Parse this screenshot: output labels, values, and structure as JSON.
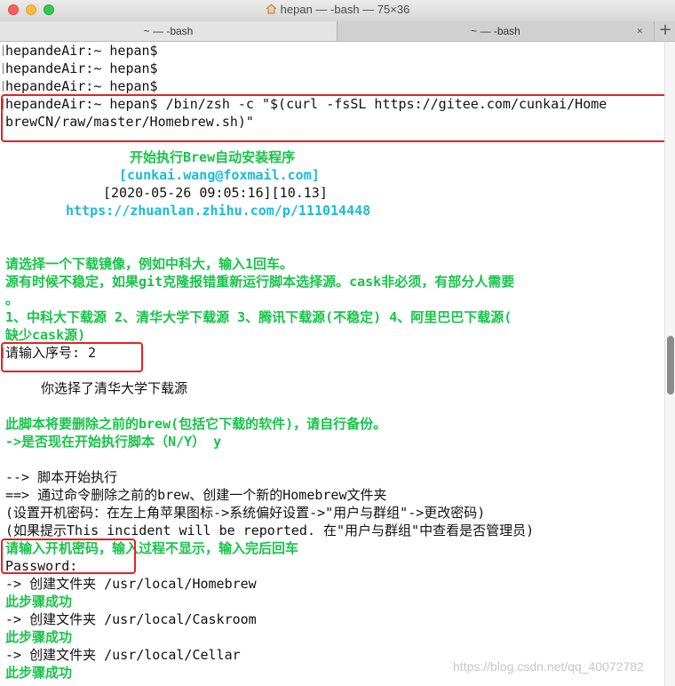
{
  "window": {
    "title": "hepan — -bash — 75×36"
  },
  "tabs": [
    {
      "label": "~ — -bash"
    },
    {
      "label": "~ — -bash"
    }
  ],
  "tab_controls": {
    "close": "×",
    "add": "+"
  },
  "terminal": {
    "lines": [
      "hepandeAir:~ hepan$",
      "hepandeAir:~ hepan$",
      "hepandeAir:~ hepan$",
      "hepandeAir:~ hepan$ /bin/zsh -c \"$(curl -fsSL https://gitee.com/cunkai/Home",
      "brewCN/raw/master/Homebrew.sh)\"",
      "开始执行Brew自动安装程序",
      "[cunkai.wang@foxmail.com]",
      "[2020-05-26 09:05:16][10.13]",
      "https://zhuanlan.zhihu.com/p/111014448",
      "请选择一个下载镜像，例如中科大，输入1回车。",
      "源有时候不稳定，如果git克隆报错重新运行脚本选择源。cask非必须，有部分人需要",
      "。",
      "1、中科大下载源 2、清华大学下载源 3、腾讯下载源(不稳定) 4、阿里巴巴下载源(",
      "缺少cask源)",
      "请输入序号: 2",
      "你选择了清华大学下载源",
      "此脚本将要删除之前的brew(包括它下载的软件)，请自行备份。",
      "->是否现在开始执行脚本（N/Y） y",
      "--> 脚本开始执行",
      "==> 通过命令删除之前的brew、创建一个新的Homebrew文件夹",
      "(设置开机密码：在左上角苹果图标->系统偏好设置->\"用户与群组\"->更改密码)",
      "(如果提示This incident will be reported. 在\"用户与群组\"中查看是否管理员)",
      "请输入开机密码，输入过程不显示，输入完后回车",
      "Password:",
      "-> 创建文件夹 /usr/local/Homebrew",
      "此步骤成功",
      "-> 创建文件夹 /usr/local/Caskroom",
      "此步骤成功",
      "-> 创建文件夹 /usr/local/Cellar",
      "此步骤成功"
    ]
  },
  "watermark": "https://blog.csdn.net/qq_40072782",
  "colors": {
    "green": "#18c44a",
    "cyan": "#1abbd9",
    "highlight_red": "#e8211f"
  }
}
